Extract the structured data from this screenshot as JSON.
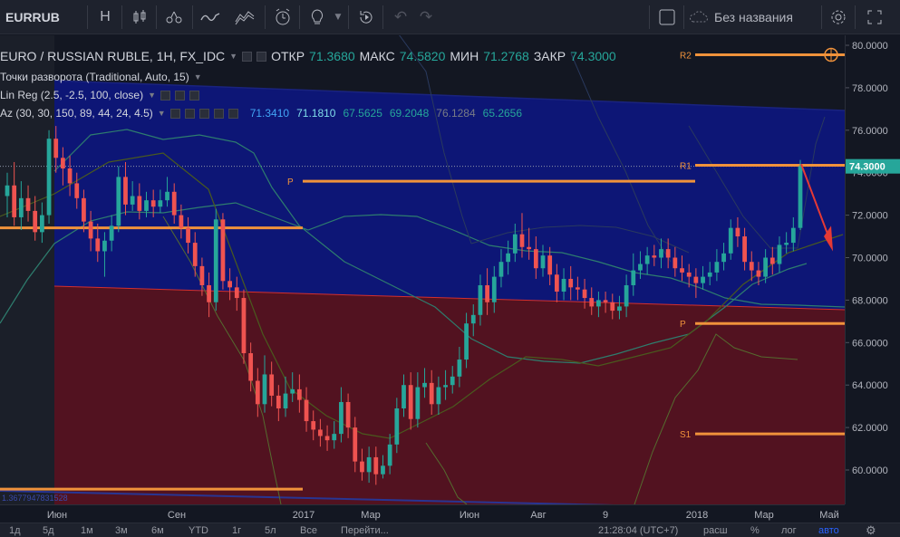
{
  "toolbar": {
    "symbol": "EURRUB",
    "interval": "H",
    "layout_name": "Без названия"
  },
  "legend": {
    "title": "EURO / RUSSIAN RUBLE, 1H, FX_IDC",
    "open_label": "ОТКР",
    "open": "71.3680",
    "high_label": "МАКС",
    "high": "74.5820",
    "low_label": "МИН",
    "low": "71.2768",
    "close_label": "ЗАКР",
    "close": "74.3000",
    "pivot_study": "Точки разворота (Traditional, Auto, 15)",
    "linreg_study": "Lin Reg (2.5, -2.5, 100, close)",
    "az_study": "Az (30, 30, 150, 89, 44, 24, 4.5)",
    "az_values": [
      "71.3410",
      "71.1810",
      "67.5625",
      "69.2048",
      "76.1284",
      "65.2656"
    ],
    "az_colors": [
      "#42a5f5",
      "#80deea",
      "#26a69a",
      "#26a69a",
      "#787b86",
      "#26a69a"
    ]
  },
  "colors": {
    "up": "#26a69a",
    "down": "#ef5350",
    "pivot": "#f0923b",
    "upper_channel": "#0d1680",
    "lower_channel": "#5a1220",
    "arrow": "#e53935"
  },
  "price_axis": {
    "ticks": [
      "80.0000",
      "78.0000",
      "76.0000",
      "74.0000",
      "72.0000",
      "70.0000",
      "68.0000",
      "66.0000",
      "64.0000",
      "62.0000",
      "60.0000"
    ],
    "last_price": "74.3000"
  },
  "pivots": {
    "r2": "R2",
    "r1": "R1",
    "p": "P",
    "s1": "S1"
  },
  "lower_left_text": "1.3677947831528",
  "time_axis": [
    "Июн",
    "Сен",
    "2017",
    "Мар",
    "Июн",
    "Авг",
    "9",
    "2018",
    "Мар",
    "Май"
  ],
  "bottom_bar": {
    "ranges": [
      "1д",
      "5д",
      "1м",
      "3м",
      "6м",
      "YTD",
      "1г",
      "5л",
      "Все"
    ],
    "goto": "Перейти...",
    "clock": "21:28:04 (UTC+7)",
    "options": [
      "расш",
      "%",
      "лог",
      "авто"
    ]
  },
  "chart_data": {
    "type": "candlestick",
    "title": "EURO / RUSSIAN RUBLE, 1H, FX_IDC",
    "ylim": [
      59,
      81
    ],
    "x_labels": [
      "Июн",
      "Сен",
      "2017",
      "Мар",
      "Июн",
      "Авг",
      "9",
      "2018",
      "Мар",
      "Май"
    ],
    "pivot_levels": {
      "R2": 79.55,
      "R1": 74.35,
      "P_2018": 66.9,
      "S1": 61.7,
      "P_2017": 73.6
    },
    "candles": [
      [
        72.9,
        73.4,
        74.0,
        71.9
      ],
      [
        73.4,
        71.9,
        74.5,
        71.5
      ],
      [
        71.9,
        72.8,
        73.6,
        71.3
      ],
      [
        72.8,
        72.2,
        73.4,
        71.7
      ],
      [
        72.2,
        71.2,
        72.9,
        70.8
      ],
      [
        71.2,
        72.0,
        72.6,
        70.7
      ],
      [
        72.0,
        75.6,
        76.0,
        71.6
      ],
      [
        75.6,
        74.7,
        76.2,
        74.0
      ],
      [
        74.7,
        74.2,
        75.2,
        73.4
      ],
      [
        74.2,
        73.5,
        74.8,
        72.9
      ],
      [
        73.5,
        72.8,
        74.0,
        72.3
      ],
      [
        72.8,
        71.7,
        73.2,
        71.2
      ],
      [
        71.7,
        70.9,
        72.2,
        70.3
      ],
      [
        70.9,
        70.3,
        71.6,
        69.8
      ],
      [
        70.3,
        70.8,
        71.2,
        69.1
      ],
      [
        70.8,
        71.5,
        72.0,
        70.3
      ],
      [
        71.5,
        73.8,
        74.3,
        71.2
      ],
      [
        73.8,
        72.5,
        74.5,
        72.0
      ],
      [
        72.5,
        72.9,
        73.6,
        72.2
      ],
      [
        72.9,
        72.2,
        73.5,
        71.8
      ],
      [
        72.2,
        72.7,
        73.1,
        71.9
      ],
      [
        72.7,
        72.4,
        73.2,
        71.9
      ],
      [
        72.4,
        72.7,
        73.2,
        72.1
      ],
      [
        72.7,
        73.1,
        73.8,
        72.4
      ],
      [
        73.1,
        72.0,
        73.5,
        71.6
      ],
      [
        72.0,
        71.4,
        72.5,
        70.9
      ],
      [
        71.4,
        70.7,
        71.9,
        70.2
      ],
      [
        70.7,
        69.6,
        71.2,
        69.1
      ],
      [
        69.6,
        68.7,
        70.0,
        68.2
      ],
      [
        68.7,
        67.9,
        69.3,
        67.2
      ],
      [
        67.9,
        71.8,
        72.3,
        67.5
      ],
      [
        71.8,
        68.9,
        72.1,
        68.5
      ],
      [
        68.9,
        68.6,
        69.5,
        68.0
      ],
      [
        68.6,
        68.1,
        69.1,
        67.5
      ],
      [
        68.1,
        65.5,
        68.5,
        65.0
      ],
      [
        65.5,
        64.2,
        66.0,
        63.7
      ],
      [
        64.2,
        63.1,
        64.8,
        62.5
      ],
      [
        63.1,
        64.5,
        65.4,
        62.7
      ],
      [
        64.5,
        63.5,
        65.1,
        63.0
      ],
      [
        63.5,
        62.9,
        64.0,
        62.3
      ],
      [
        62.9,
        63.6,
        64.4,
        62.5
      ],
      [
        63.6,
        63.8,
        64.6,
        63.2
      ],
      [
        63.8,
        63.3,
        64.5,
        62.7
      ],
      [
        63.3,
        62.3,
        63.9,
        61.8
      ],
      [
        62.3,
        61.9,
        62.8,
        61.4
      ],
      [
        61.9,
        61.6,
        62.4,
        61.1
      ],
      [
        61.6,
        61.4,
        62.1,
        60.9
      ],
      [
        61.4,
        61.7,
        62.3,
        61.0
      ],
      [
        61.7,
        63.2,
        63.9,
        61.3
      ],
      [
        63.2,
        62.0,
        63.6,
        61.5
      ],
      [
        62.0,
        60.4,
        62.5,
        59.9
      ],
      [
        60.4,
        59.9,
        61.0,
        59.5
      ],
      [
        59.9,
        60.6,
        61.1,
        59.4
      ],
      [
        60.6,
        59.8,
        61.1,
        59.3
      ],
      [
        59.8,
        60.2,
        60.7,
        59.6
      ],
      [
        60.2,
        61.2,
        61.7,
        59.8
      ],
      [
        61.2,
        62.9,
        63.4,
        60.8
      ],
      [
        62.9,
        64.0,
        64.5,
        62.5
      ],
      [
        64.0,
        62.4,
        64.6,
        61.9
      ],
      [
        62.4,
        63.9,
        64.6,
        62.0
      ],
      [
        63.9,
        64.1,
        64.8,
        63.4
      ],
      [
        64.1,
        63.1,
        64.7,
        62.6
      ],
      [
        63.1,
        63.9,
        64.4,
        62.6
      ],
      [
        63.9,
        64.0,
        64.7,
        63.3
      ],
      [
        64.0,
        64.4,
        64.9,
        63.6
      ],
      [
        64.4,
        65.2,
        65.8,
        63.9
      ],
      [
        65.2,
        66.9,
        67.4,
        64.8
      ],
      [
        66.9,
        67.3,
        67.8,
        66.3
      ],
      [
        67.3,
        68.7,
        69.2,
        66.8
      ],
      [
        68.7,
        67.9,
        69.5,
        67.3
      ],
      [
        67.9,
        69.1,
        69.6,
        67.4
      ],
      [
        69.1,
        69.8,
        70.4,
        68.6
      ],
      [
        69.8,
        70.2,
        70.8,
        69.2
      ],
      [
        70.2,
        71.1,
        71.6,
        69.8
      ],
      [
        71.1,
        70.5,
        72.1,
        70.0
      ],
      [
        70.5,
        70.4,
        71.4,
        69.9
      ],
      [
        70.4,
        69.5,
        71.0,
        69.0
      ],
      [
        69.5,
        70.1,
        70.6,
        69.1
      ],
      [
        70.1,
        69.2,
        70.5,
        68.7
      ],
      [
        69.2,
        68.4,
        69.7,
        67.9
      ],
      [
        68.4,
        69.0,
        69.5,
        68.0
      ],
      [
        69.0,
        68.6,
        69.6,
        68.0
      ],
      [
        68.6,
        68.5,
        69.1,
        68.0
      ],
      [
        68.5,
        68.1,
        69.0,
        67.6
      ],
      [
        68.1,
        67.7,
        68.6,
        67.3
      ],
      [
        67.7,
        68.0,
        68.4,
        67.2
      ],
      [
        68.0,
        67.9,
        68.4,
        67.4
      ],
      [
        67.9,
        67.5,
        68.3,
        67.1
      ],
      [
        67.5,
        67.7,
        68.2,
        67.1
      ],
      [
        67.7,
        68.7,
        69.2,
        67.2
      ],
      [
        68.7,
        69.4,
        70.2,
        68.2
      ],
      [
        69.4,
        69.7,
        70.3,
        69.0
      ],
      [
        69.7,
        70.1,
        70.5,
        69.2
      ],
      [
        70.1,
        70.0,
        70.6,
        69.6
      ],
      [
        70.0,
        70.4,
        70.9,
        69.5
      ],
      [
        70.4,
        70.0,
        70.9,
        69.5
      ],
      [
        70.0,
        69.5,
        70.5,
        69.1
      ],
      [
        69.5,
        69.3,
        70.1,
        68.9
      ],
      [
        69.3,
        69.1,
        69.7,
        68.6
      ],
      [
        69.1,
        68.8,
        69.5,
        68.1
      ],
      [
        68.8,
        69.1,
        69.6,
        68.5
      ],
      [
        69.1,
        69.3,
        69.8,
        68.7
      ],
      [
        69.3,
        69.8,
        70.4,
        68.9
      ],
      [
        69.8,
        70.2,
        70.7,
        69.4
      ],
      [
        70.2,
        71.4,
        71.8,
        69.9
      ],
      [
        71.4,
        71.0,
        71.9,
        70.5
      ],
      [
        71.0,
        69.8,
        71.4,
        69.4
      ],
      [
        69.8,
        69.4,
        70.3,
        68.9
      ],
      [
        69.4,
        69.1,
        69.8,
        68.7
      ],
      [
        69.1,
        70.0,
        70.4,
        68.8
      ],
      [
        70.0,
        69.7,
        70.5,
        69.2
      ],
      [
        69.7,
        70.6,
        71.0,
        69.3
      ],
      [
        70.6,
        70.7,
        71.2,
        70.2
      ],
      [
        70.7,
        71.4,
        71.9,
        70.3
      ],
      [
        71.4,
        74.3,
        74.6,
        71.3
      ]
    ]
  }
}
